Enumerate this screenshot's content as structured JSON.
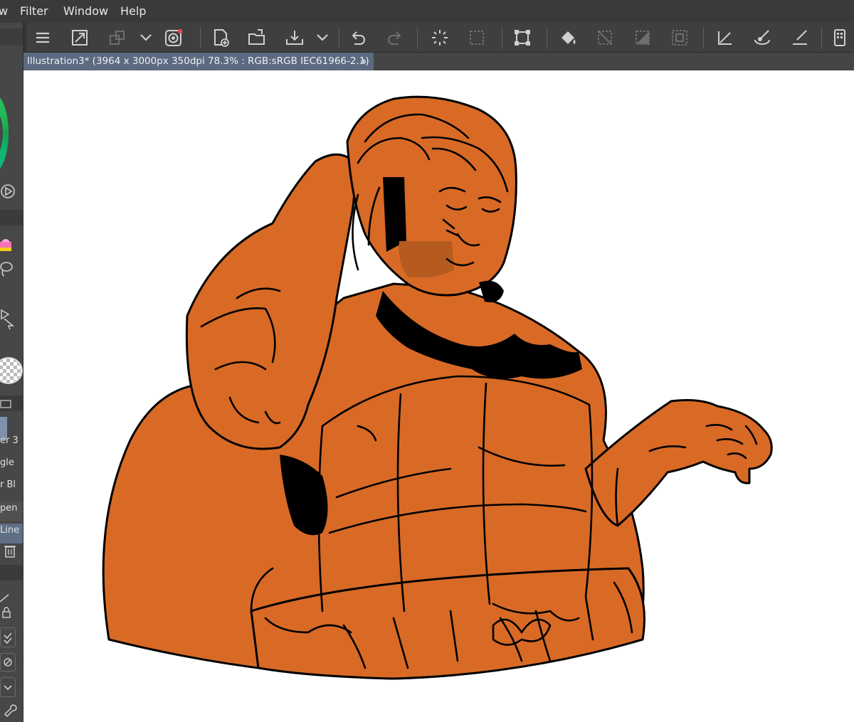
{
  "menu": {
    "items": [
      "w",
      "Filter",
      "Window",
      "Help"
    ]
  },
  "document": {
    "tab_title": "Illustration3* (3964 x 3000px 350dpi 78.3% : RGB:sRGB IEC61966-2.1)"
  },
  "left_panel": {
    "layer_labels": [
      "er 3",
      "gle",
      "r Bl",
      "pen",
      "Line"
    ]
  },
  "toolbar": {
    "icons": [
      "menu-icon",
      "resize-icon",
      "transfer-icon",
      "chevron-down-icon",
      "record-icon",
      "new-file-icon",
      "open-folder-icon",
      "save-icon",
      "chevron-down-icon",
      "undo-icon",
      "redo-icon",
      "loading-icon",
      "deselect-icon",
      "transform-icon",
      "fill-icon",
      "clear-selection-icon",
      "invert-selection-icon",
      "selection-border-icon",
      "ruler-icon",
      "brush-icon",
      "pen-icon",
      "tablet-icon"
    ]
  },
  "colors": {
    "ui_dark": "#3a3a3a",
    "ui_panel": "#474747",
    "tab_active": "#5b6a80",
    "canvas_bg": "#ffffff",
    "fill_orange": "#d86a26",
    "shadow_orange": "#b65b1f",
    "line_black": "#000000"
  },
  "canvas": {
    "subject": "digital sketch of a stout armored figure, flat orange fill with black linework"
  }
}
